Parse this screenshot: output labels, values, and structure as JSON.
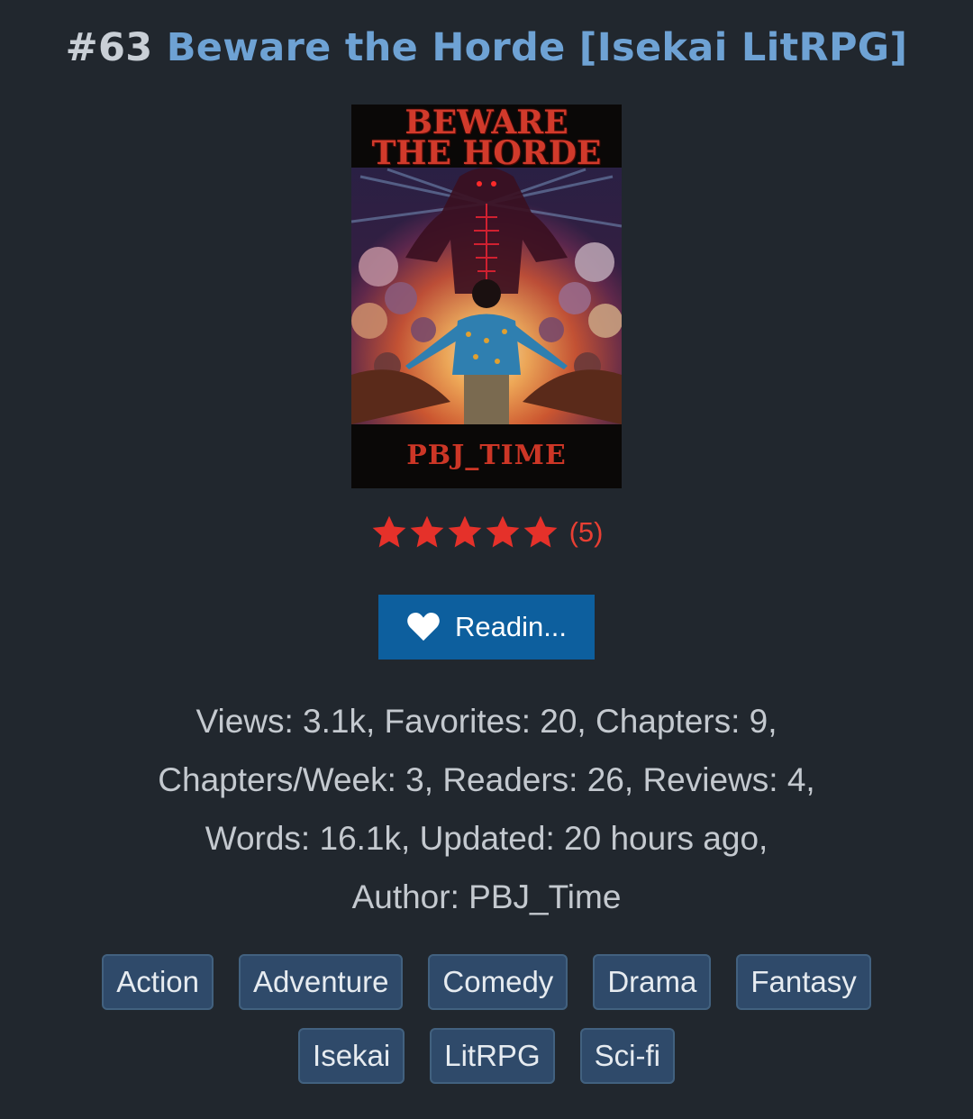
{
  "header": {
    "rank": "#63",
    "title": "Beware the Horde [Isekai LitRPG]"
  },
  "cover": {
    "title_line1": "BEWARE",
    "title_line2": "THE HORDE",
    "author": "PBJ_TIME"
  },
  "rating": {
    "stars": 5,
    "max_stars": 5,
    "count": "(5)",
    "star_color": "#e5312a"
  },
  "read_button": {
    "label": "Readin...",
    "icon": "heart-icon"
  },
  "stats": {
    "line1": "Views: 3.1k, Favorites: 20, Chapters: 9,",
    "line2": "Chapters/Week: 3, Readers: 26, Reviews: 4,",
    "line3": "Words: 16.1k, Updated: 20 hours ago,",
    "line4": "Author: PBJ_Time"
  },
  "tags": [
    "Action",
    "Adventure",
    "Comedy",
    "Drama",
    "Fantasy",
    "Isekai",
    "LitRPG",
    "Sci-fi"
  ],
  "colors": {
    "background": "#21272e",
    "title_link": "#6ea2d4",
    "button": "#0d5f9e",
    "tag": "#2f4a6a"
  }
}
